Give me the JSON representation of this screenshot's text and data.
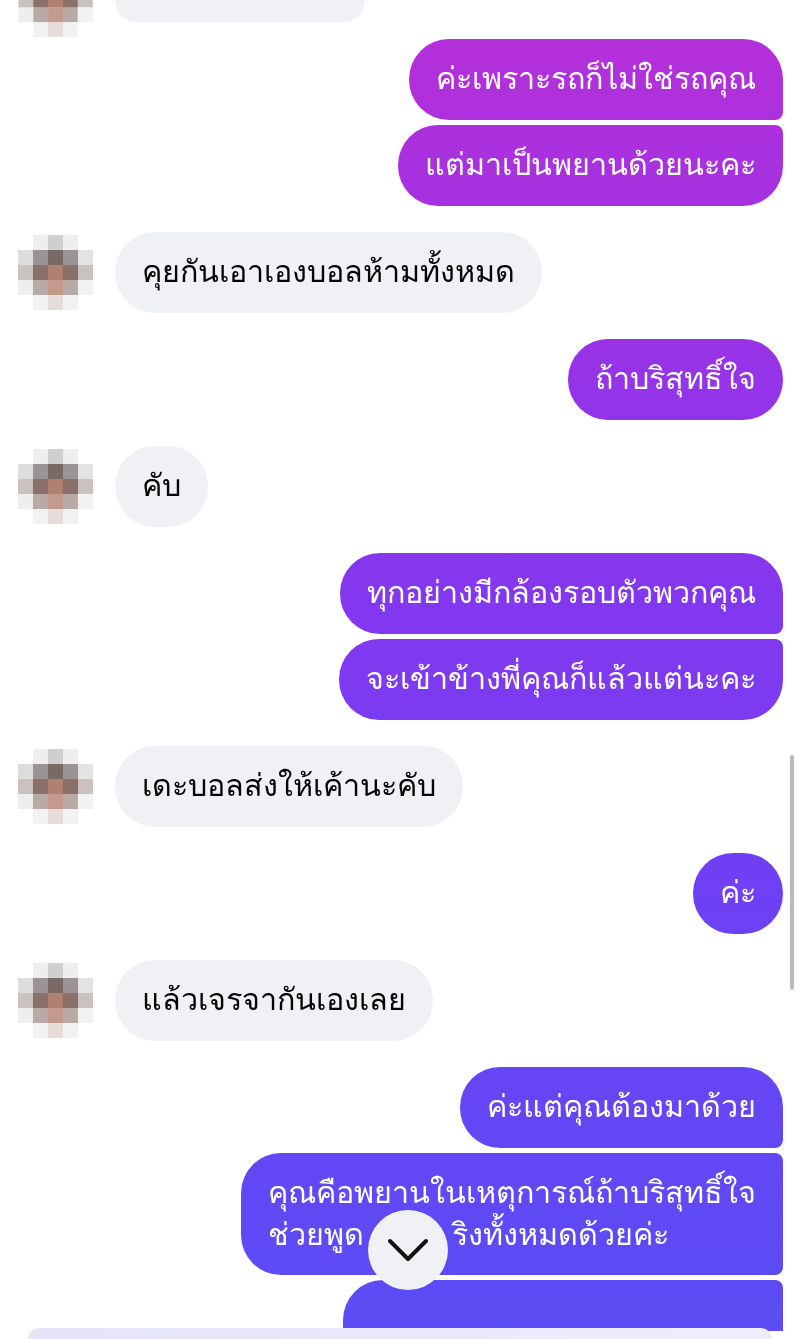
{
  "groups": [
    {
      "outgoing": false,
      "messages": [
        {
          "kind": "partial"
        }
      ]
    },
    {
      "outgoing": true,
      "messages": [
        {
          "kind": "text",
          "text": "ค่ะเพราะรถก็ไม่ใช่รถคุณ"
        },
        {
          "kind": "text",
          "text": "แต่มาเป็นพยานด้วยนะคะ"
        }
      ]
    },
    {
      "outgoing": false,
      "messages": [
        {
          "kind": "text",
          "text": "คุยกันเอาเองบอลห้ามทั้งหมด"
        }
      ]
    },
    {
      "outgoing": true,
      "messages": [
        {
          "kind": "text",
          "text": "ถ้าบริสุทธิ์ใจ"
        }
      ]
    },
    {
      "outgoing": false,
      "messages": [
        {
          "kind": "text",
          "text": "คับ"
        }
      ]
    },
    {
      "outgoing": true,
      "messages": [
        {
          "kind": "text",
          "text": "ทุกอย่างมีกล้องรอบตัวพวกคุณ"
        },
        {
          "kind": "text",
          "text": "จะเข้าข้างพี่คุณก็แล้วแต่นะคะ"
        }
      ]
    },
    {
      "outgoing": false,
      "messages": [
        {
          "kind": "text",
          "text": "เดะบอลส่งให้เค้านะคับ"
        }
      ]
    },
    {
      "outgoing": true,
      "messages": [
        {
          "kind": "text",
          "text": "ค่ะ"
        }
      ]
    },
    {
      "outgoing": false,
      "messages": [
        {
          "kind": "text",
          "text": "แล้วเจรจากันเองเลย"
        }
      ]
    },
    {
      "outgoing": true,
      "messages": [
        {
          "kind": "text",
          "text": "ค่ะแต่คุณต้องมาด้วย"
        },
        {
          "kind": "covered",
          "text": "คุณคือพยานในเหตุการณ์ถ้าบริสุทธิ์ใจ",
          "before": "ช่วยพูด",
          "after": "ริงทั้งหมดด้วยค่ะ"
        },
        {
          "kind": "partial"
        }
      ]
    }
  ]
}
